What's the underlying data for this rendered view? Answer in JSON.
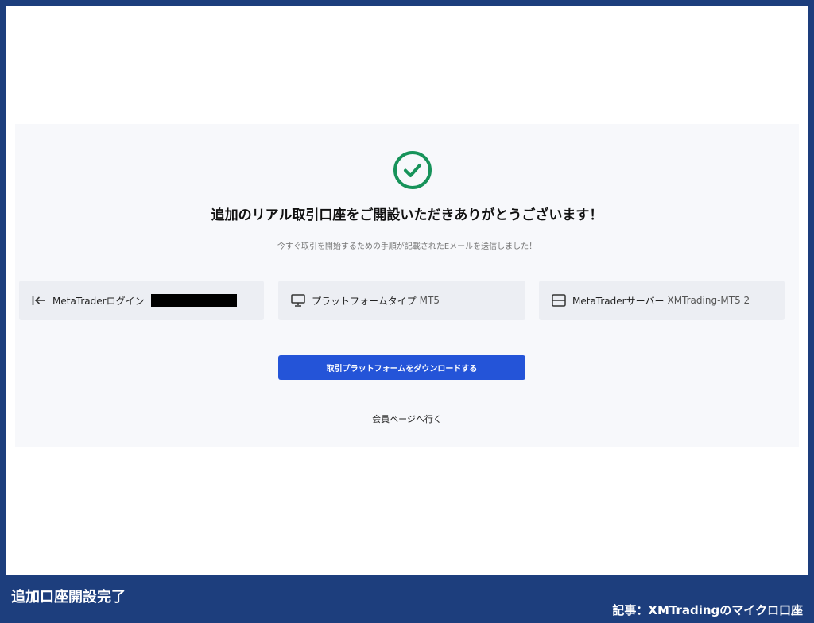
{
  "panel": {
    "headline": "追加のリアル取引口座をご開設いただきありがとうございます！",
    "subtext": "今すぐ取引を開始するための手順が記載されたEメールを送信しました！",
    "cards": [
      {
        "label": "MetaTraderログイン",
        "value": "",
        "icon": "login-arrow-icon"
      },
      {
        "label": "プラットフォームタイプ",
        "value": "MT5",
        "icon": "monitor-icon"
      },
      {
        "label": "MetaTraderサーバー",
        "value": "XMTrading-MT5 2",
        "icon": "server-icon"
      }
    ],
    "download_button": "取引プラットフォームをダウンロードする",
    "member_link": "会員ページへ行く"
  },
  "caption": {
    "left": "追加口座開設完了",
    "right": "記事：XMTradingのマイクロ口座"
  },
  "colors": {
    "frame_border": "#1d3e7d",
    "check_green": "#17935a",
    "button_blue": "#2454d8"
  }
}
